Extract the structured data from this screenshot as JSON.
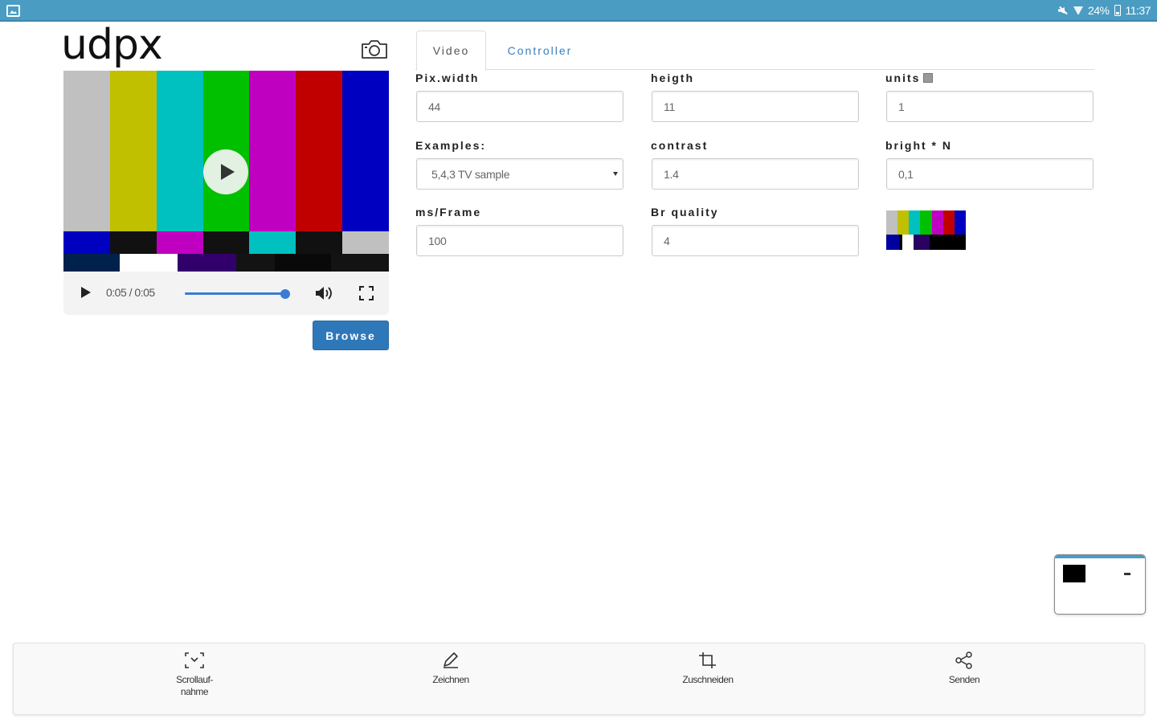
{
  "status_bar": {
    "battery": "24%",
    "time": "11:37"
  },
  "app": {
    "logo": "udpx"
  },
  "player": {
    "time_display": "0:05 / 0:05",
    "progress_fraction": 1.0,
    "bar_colors_top": [
      "#c0c0c0",
      "#c0c000",
      "#00c0c0",
      "#00c000",
      "#c000c0",
      "#c00000",
      "#0000c0"
    ],
    "bar_colors_mid": [
      "#0000c0",
      "#111111",
      "#c000c0",
      "#111111",
      "#00c0c0",
      "#111111",
      "#c0c0c0"
    ],
    "bar_colors_bot": [
      "#00214c",
      "#ffffff",
      "#32006a",
      "#131313",
      "#090909",
      "#131313",
      "#1d1d1d"
    ]
  },
  "browse_button": "Browse",
  "tabs": [
    {
      "label": "Video",
      "active": true
    },
    {
      "label": "Controller",
      "active": false
    }
  ],
  "form": {
    "pix_width": {
      "label": "Pix.width",
      "value": "44"
    },
    "heigth": {
      "label": "heigth",
      "value": "11"
    },
    "units": {
      "label": "units",
      "value": "1"
    },
    "examples": {
      "label": "Examples:",
      "value": "5,4,3 TV sample"
    },
    "contrast": {
      "label": "contrast",
      "value": "1.4"
    },
    "bright": {
      "label": "bright * N",
      "value": "0,1"
    },
    "ms_frame": {
      "label": "ms/Frame",
      "value": "100"
    },
    "br_quality": {
      "label": "Br quality",
      "value": "4"
    }
  },
  "toolbar": {
    "scroll_capture": "Scrollauf-\nnahme",
    "draw": "Zeichnen",
    "crop": "Zuschneiden",
    "share": "Senden"
  },
  "colors": {
    "status_bar": "#4a9cc2",
    "accent": "#2e78b9",
    "tab_link": "#3a7ebf"
  }
}
